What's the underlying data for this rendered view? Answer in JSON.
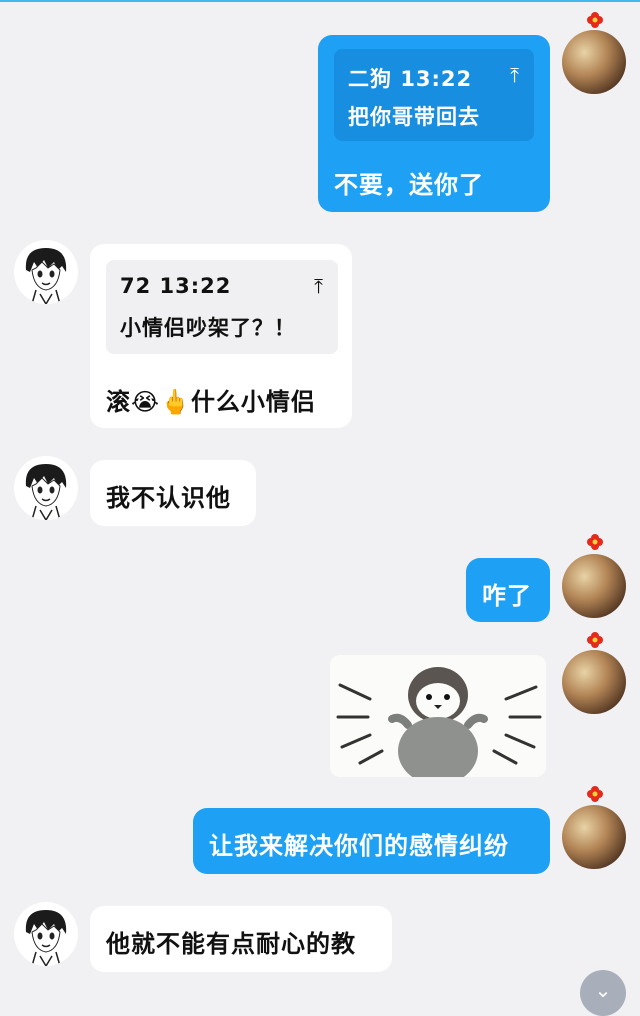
{
  "messages": [
    {
      "id": "m1",
      "direction": "outgoing",
      "quote": {
        "author": "二狗",
        "time": "13:22",
        "text": "把你哥带回去",
        "arrow": "⤒"
      },
      "text": "不要，送你了"
    },
    {
      "id": "m2",
      "direction": "incoming",
      "quote": {
        "author": "72",
        "time": "13:22",
        "text": "小情侣吵架了？！",
        "arrow": "⤒"
      },
      "text_before": "滚",
      "emoji1": "😭",
      "emoji2": "🖕",
      "text_after": "什么小情侣"
    },
    {
      "id": "m3",
      "direction": "incoming",
      "text": "我不认识他"
    },
    {
      "id": "m4",
      "direction": "outgoing",
      "text": "咋了"
    },
    {
      "id": "m5",
      "direction": "outgoing",
      "type": "sticker",
      "sticker": "penguin-sticker"
    },
    {
      "id": "m6",
      "direction": "outgoing",
      "text": "让我来解决你们的感情纠纷"
    },
    {
      "id": "m7",
      "direction": "incoming",
      "text": "他就不能有点耐心的教"
    }
  ],
  "scroll_button": {
    "icon": "chevron-down-icon",
    "glyph": "⌄"
  },
  "colors": {
    "outgoing_bubble": "#1ea0f5",
    "incoming_bubble": "#ffffff",
    "background": "#f1f1f3"
  }
}
